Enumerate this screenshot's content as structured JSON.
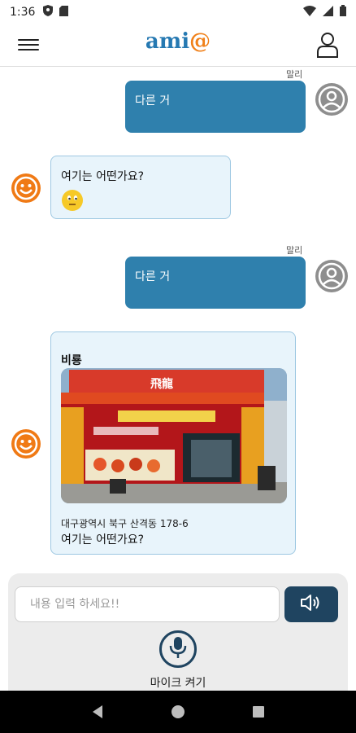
{
  "status_bar": {
    "time": "1:36"
  },
  "header": {
    "logo_main": "ami",
    "logo_at": "@",
    "menu_icon": "menu-icon",
    "profile_icon": "profile-icon"
  },
  "messages": [
    {
      "role": "user",
      "sender": "말리",
      "text": "다른 거"
    },
    {
      "role": "bot",
      "text": "여기는 어떤가요?",
      "emoji": "neutral-face-emoji"
    },
    {
      "role": "user",
      "sender": "말리",
      "text": "다른 거"
    },
    {
      "role": "bot",
      "place_name": "비룡",
      "address": "대구광역시 북구 산격동 178-6",
      "text": "여기는 어떤가요?"
    }
  ],
  "input": {
    "placeholder": "내용 입력 하세요!!",
    "value": ""
  },
  "mic": {
    "label": "마이크 켜기"
  },
  "colors": {
    "accent_blue": "#2f80ad",
    "logo_orange": "#f08019",
    "dark_navy": "#1f4460",
    "bot_bubble": "#e8f4fb"
  }
}
